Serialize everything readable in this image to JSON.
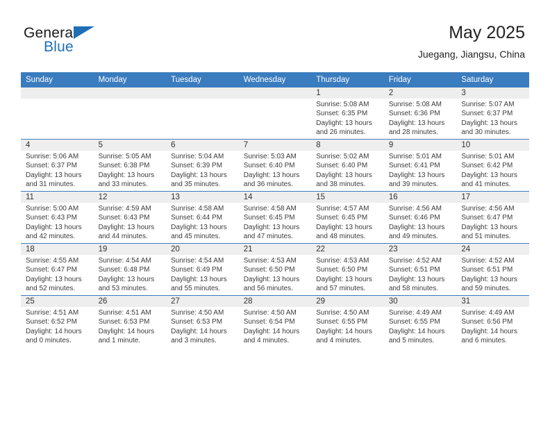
{
  "brand": {
    "name_part1": "General",
    "name_part2": "Blue",
    "logo_icon": "triangle-logo"
  },
  "header": {
    "title": "May 2025",
    "subtitle": "Juegang, Jiangsu, China"
  },
  "colors": {
    "header_blue": "#3a7cbe",
    "brand_blue": "#1f6fb5",
    "daynum_band": "#eeeeee"
  },
  "weekday_headers": [
    "Sunday",
    "Monday",
    "Tuesday",
    "Wednesday",
    "Thursday",
    "Friday",
    "Saturday"
  ],
  "weeks": [
    [
      {
        "day": "",
        "empty": true
      },
      {
        "day": "",
        "empty": true
      },
      {
        "day": "",
        "empty": true
      },
      {
        "day": "",
        "empty": true
      },
      {
        "day": "1",
        "sunrise": "Sunrise: 5:08 AM",
        "sunset": "Sunset: 6:35 PM",
        "daylight_1": "Daylight: 13 hours",
        "daylight_2": "and 26 minutes."
      },
      {
        "day": "2",
        "sunrise": "Sunrise: 5:08 AM",
        "sunset": "Sunset: 6:36 PM",
        "daylight_1": "Daylight: 13 hours",
        "daylight_2": "and 28 minutes."
      },
      {
        "day": "3",
        "sunrise": "Sunrise: 5:07 AM",
        "sunset": "Sunset: 6:37 PM",
        "daylight_1": "Daylight: 13 hours",
        "daylight_2": "and 30 minutes."
      }
    ],
    [
      {
        "day": "4",
        "sunrise": "Sunrise: 5:06 AM",
        "sunset": "Sunset: 6:37 PM",
        "daylight_1": "Daylight: 13 hours",
        "daylight_2": "and 31 minutes."
      },
      {
        "day": "5",
        "sunrise": "Sunrise: 5:05 AM",
        "sunset": "Sunset: 6:38 PM",
        "daylight_1": "Daylight: 13 hours",
        "daylight_2": "and 33 minutes."
      },
      {
        "day": "6",
        "sunrise": "Sunrise: 5:04 AM",
        "sunset": "Sunset: 6:39 PM",
        "daylight_1": "Daylight: 13 hours",
        "daylight_2": "and 35 minutes."
      },
      {
        "day": "7",
        "sunrise": "Sunrise: 5:03 AM",
        "sunset": "Sunset: 6:40 PM",
        "daylight_1": "Daylight: 13 hours",
        "daylight_2": "and 36 minutes."
      },
      {
        "day": "8",
        "sunrise": "Sunrise: 5:02 AM",
        "sunset": "Sunset: 6:40 PM",
        "daylight_1": "Daylight: 13 hours",
        "daylight_2": "and 38 minutes."
      },
      {
        "day": "9",
        "sunrise": "Sunrise: 5:01 AM",
        "sunset": "Sunset: 6:41 PM",
        "daylight_1": "Daylight: 13 hours",
        "daylight_2": "and 39 minutes."
      },
      {
        "day": "10",
        "sunrise": "Sunrise: 5:01 AM",
        "sunset": "Sunset: 6:42 PM",
        "daylight_1": "Daylight: 13 hours",
        "daylight_2": "and 41 minutes."
      }
    ],
    [
      {
        "day": "11",
        "sunrise": "Sunrise: 5:00 AM",
        "sunset": "Sunset: 6:43 PM",
        "daylight_1": "Daylight: 13 hours",
        "daylight_2": "and 42 minutes."
      },
      {
        "day": "12",
        "sunrise": "Sunrise: 4:59 AM",
        "sunset": "Sunset: 6:43 PM",
        "daylight_1": "Daylight: 13 hours",
        "daylight_2": "and 44 minutes."
      },
      {
        "day": "13",
        "sunrise": "Sunrise: 4:58 AM",
        "sunset": "Sunset: 6:44 PM",
        "daylight_1": "Daylight: 13 hours",
        "daylight_2": "and 45 minutes."
      },
      {
        "day": "14",
        "sunrise": "Sunrise: 4:58 AM",
        "sunset": "Sunset: 6:45 PM",
        "daylight_1": "Daylight: 13 hours",
        "daylight_2": "and 47 minutes."
      },
      {
        "day": "15",
        "sunrise": "Sunrise: 4:57 AM",
        "sunset": "Sunset: 6:45 PM",
        "daylight_1": "Daylight: 13 hours",
        "daylight_2": "and 48 minutes."
      },
      {
        "day": "16",
        "sunrise": "Sunrise: 4:56 AM",
        "sunset": "Sunset: 6:46 PM",
        "daylight_1": "Daylight: 13 hours",
        "daylight_2": "and 49 minutes."
      },
      {
        "day": "17",
        "sunrise": "Sunrise: 4:56 AM",
        "sunset": "Sunset: 6:47 PM",
        "daylight_1": "Daylight: 13 hours",
        "daylight_2": "and 51 minutes."
      }
    ],
    [
      {
        "day": "18",
        "sunrise": "Sunrise: 4:55 AM",
        "sunset": "Sunset: 6:47 PM",
        "daylight_1": "Daylight: 13 hours",
        "daylight_2": "and 52 minutes."
      },
      {
        "day": "19",
        "sunrise": "Sunrise: 4:54 AM",
        "sunset": "Sunset: 6:48 PM",
        "daylight_1": "Daylight: 13 hours",
        "daylight_2": "and 53 minutes."
      },
      {
        "day": "20",
        "sunrise": "Sunrise: 4:54 AM",
        "sunset": "Sunset: 6:49 PM",
        "daylight_1": "Daylight: 13 hours",
        "daylight_2": "and 55 minutes."
      },
      {
        "day": "21",
        "sunrise": "Sunrise: 4:53 AM",
        "sunset": "Sunset: 6:50 PM",
        "daylight_1": "Daylight: 13 hours",
        "daylight_2": "and 56 minutes."
      },
      {
        "day": "22",
        "sunrise": "Sunrise: 4:53 AM",
        "sunset": "Sunset: 6:50 PM",
        "daylight_1": "Daylight: 13 hours",
        "daylight_2": "and 57 minutes."
      },
      {
        "day": "23",
        "sunrise": "Sunrise: 4:52 AM",
        "sunset": "Sunset: 6:51 PM",
        "daylight_1": "Daylight: 13 hours",
        "daylight_2": "and 58 minutes."
      },
      {
        "day": "24",
        "sunrise": "Sunrise: 4:52 AM",
        "sunset": "Sunset: 6:51 PM",
        "daylight_1": "Daylight: 13 hours",
        "daylight_2": "and 59 minutes."
      }
    ],
    [
      {
        "day": "25",
        "sunrise": "Sunrise: 4:51 AM",
        "sunset": "Sunset: 6:52 PM",
        "daylight_1": "Daylight: 14 hours",
        "daylight_2": "and 0 minutes."
      },
      {
        "day": "26",
        "sunrise": "Sunrise: 4:51 AM",
        "sunset": "Sunset: 6:53 PM",
        "daylight_1": "Daylight: 14 hours",
        "daylight_2": "and 1 minute."
      },
      {
        "day": "27",
        "sunrise": "Sunrise: 4:50 AM",
        "sunset": "Sunset: 6:53 PM",
        "daylight_1": "Daylight: 14 hours",
        "daylight_2": "and 3 minutes."
      },
      {
        "day": "28",
        "sunrise": "Sunrise: 4:50 AM",
        "sunset": "Sunset: 6:54 PM",
        "daylight_1": "Daylight: 14 hours",
        "daylight_2": "and 4 minutes."
      },
      {
        "day": "29",
        "sunrise": "Sunrise: 4:50 AM",
        "sunset": "Sunset: 6:55 PM",
        "daylight_1": "Daylight: 14 hours",
        "daylight_2": "and 4 minutes."
      },
      {
        "day": "30",
        "sunrise": "Sunrise: 4:49 AM",
        "sunset": "Sunset: 6:55 PM",
        "daylight_1": "Daylight: 14 hours",
        "daylight_2": "and 5 minutes."
      },
      {
        "day": "31",
        "sunrise": "Sunrise: 4:49 AM",
        "sunset": "Sunset: 6:56 PM",
        "daylight_1": "Daylight: 14 hours",
        "daylight_2": "and 6 minutes."
      }
    ]
  ]
}
